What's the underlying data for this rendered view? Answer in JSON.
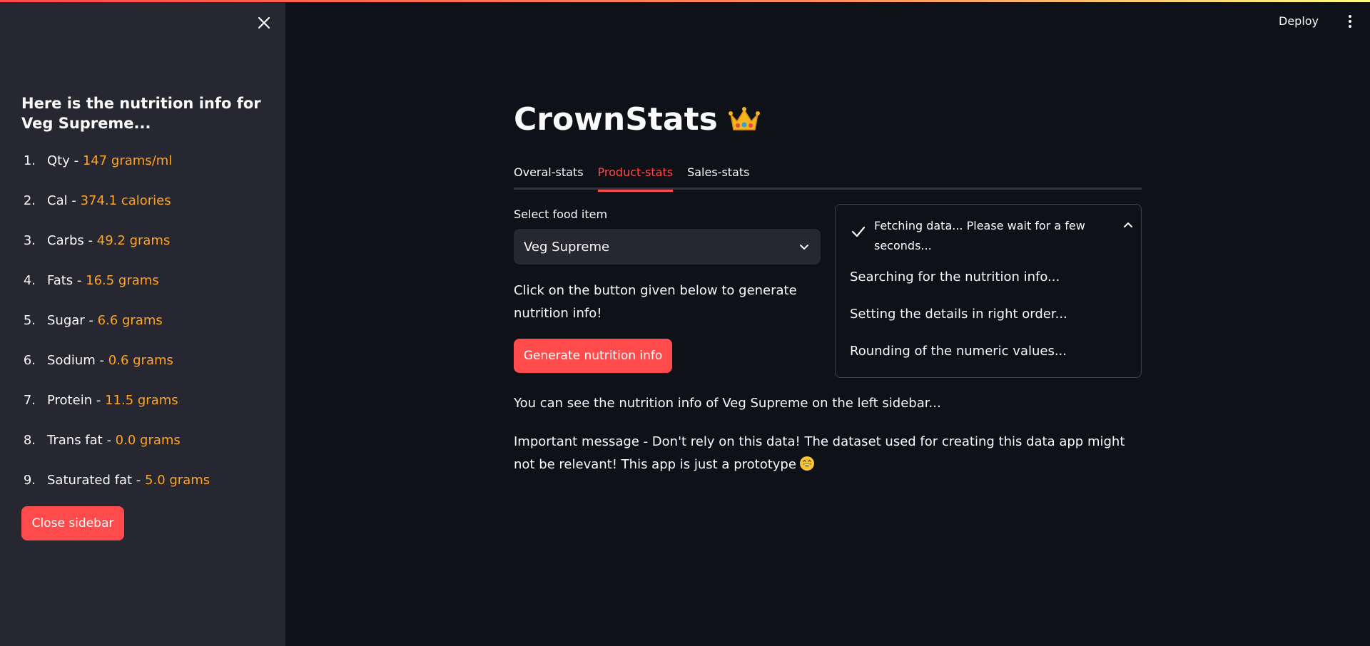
{
  "sidebar": {
    "heading": "Here is the nutrition info for Veg Supreme...",
    "items": [
      {
        "num": "1.",
        "label": "Qty",
        "value": "147 grams/ml"
      },
      {
        "num": "2.",
        "label": "Cal",
        "value": "374.1 calories"
      },
      {
        "num": "3.",
        "label": "Carbs",
        "value": "49.2 grams"
      },
      {
        "num": "4.",
        "label": "Fats",
        "value": "16.5 grams"
      },
      {
        "num": "5.",
        "label": "Sugar",
        "value": "6.6 grams"
      },
      {
        "num": "6.",
        "label": "Sodium",
        "value": "0.6 grams"
      },
      {
        "num": "7.",
        "label": "Protein",
        "value": "11.5 grams"
      },
      {
        "num": "8.",
        "label": "Trans fat",
        "value": "0.0 grams"
      },
      {
        "num": "9.",
        "label": "Saturated fat",
        "value": "5.0 grams"
      }
    ],
    "separator": " - ",
    "close_button": "Close sidebar",
    "close_icon": "close-icon"
  },
  "header": {
    "deploy_label": "Deploy",
    "menu_icon": "kebab-menu-icon"
  },
  "main": {
    "title": "CrownStats",
    "title_icon": "crown-icon",
    "tabs": [
      {
        "label": "Overal-stats",
        "active": false
      },
      {
        "label": "Product-stats",
        "active": true
      },
      {
        "label": "Sales-stats",
        "active": false
      }
    ],
    "select_label": "Select food item",
    "select_value": "Veg Supreme",
    "instruction": "Click on the button given below to generate nutrition info!",
    "generate_button": "Generate nutrition info",
    "status": {
      "title": "Fetching data... Please wait for a few seconds...",
      "steps": [
        "Searching for the nutrition info...",
        "Setting the details in right order...",
        "Rounding of the numeric values..."
      ]
    },
    "info_line": "You can see the nutrition info of Veg Supreme on the left sidebar...",
    "important_message": "Important message - Don't rely on this data! The dataset used for creating this data app might not be relevant! This app is just a prototype"
  },
  "colors": {
    "background": "#0e1117",
    "sidebar": "#262730",
    "accent": "#ff4b4b",
    "value": "#ffa421",
    "text": "#fafafa"
  }
}
